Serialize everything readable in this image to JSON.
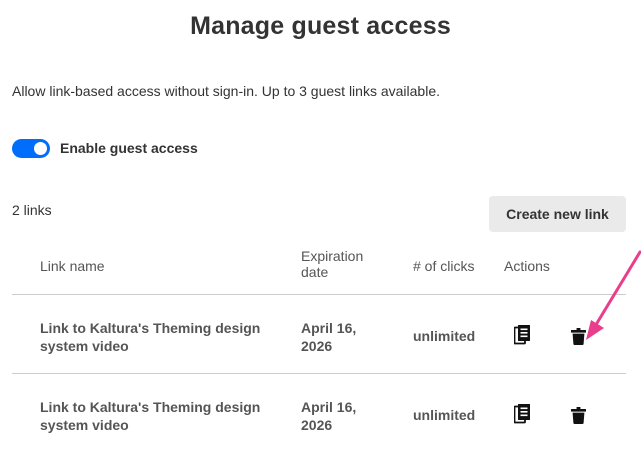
{
  "dialog": {
    "title": "Manage guest access",
    "description": "Allow link-based access without sign-in. Up to 3 guest links available."
  },
  "toggle": {
    "label": "Enable guest access",
    "enabled": true
  },
  "links_count": "2 links",
  "create_button_label": "Create new link",
  "table": {
    "headers": {
      "name": "Link name",
      "expiration_line1": "Expiration",
      "expiration_line2": "date",
      "clicks": "# of clicks",
      "actions": "Actions"
    },
    "rows": [
      {
        "name_line1": "Link to Kaltura's Theming design",
        "name_line2": "system video",
        "exp_line1": "April 16,",
        "exp_line2": "2026",
        "clicks": "unlimited"
      },
      {
        "name_line1": "Link to Kaltura's Theming design",
        "name_line2": "system video",
        "exp_line1": "April 16,",
        "exp_line2": "2026",
        "clicks": "unlimited"
      }
    ]
  },
  "icons": {
    "copy": "copy-icon",
    "delete": "trash-icon",
    "annotation": "arrow-pointer"
  },
  "colors": {
    "toggle_on": "#006efa",
    "arrow": "#e83e8c",
    "button_bg": "#eaeaea",
    "divider": "#cccccc"
  }
}
